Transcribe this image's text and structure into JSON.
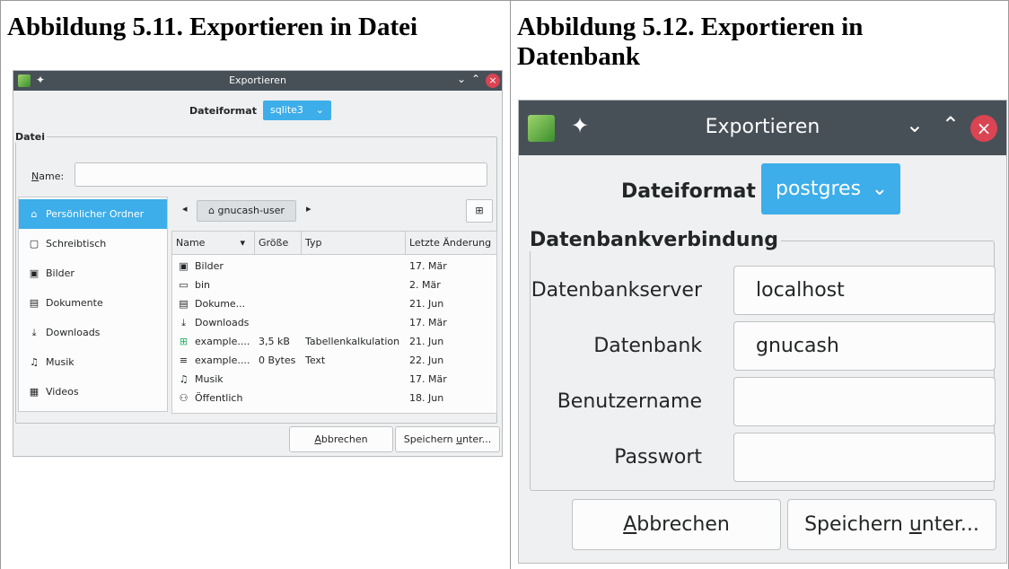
{
  "captions": {
    "left": "Abbildung 5.11. Exportieren in Datei",
    "right": "Abbildung 5.12. Exportieren in Datenbank"
  },
  "file_dialog": {
    "window_title": "Exportieren",
    "format_label": "Dateiformat",
    "format_value": "sqlite3",
    "group_label": "Datei",
    "name_label": "Name:",
    "name_value": "",
    "places": [
      {
        "label": "Persönlicher Ordner",
        "icon": "home-icon",
        "selected": true
      },
      {
        "label": "Schreibtisch",
        "icon": "desktop-icon"
      },
      {
        "label": "Bilder",
        "icon": "pictures-icon"
      },
      {
        "label": "Dokumente",
        "icon": "documents-icon"
      },
      {
        "label": "Downloads",
        "icon": "downloads-icon"
      },
      {
        "label": "Musik",
        "icon": "music-icon"
      },
      {
        "label": "Videos",
        "icon": "videos-icon"
      }
    ],
    "breadcrumb": "gnucash-user",
    "columns": {
      "name": "Name",
      "size": "Größe",
      "type": "Typ",
      "modified": "Letzte Änderung"
    },
    "files": [
      {
        "name": "Bilder",
        "size": "",
        "type": "",
        "modified": "17. Mär",
        "icon": "pictures-icon"
      },
      {
        "name": "bin",
        "size": "",
        "type": "",
        "modified": "2. Mär",
        "icon": "folder-icon"
      },
      {
        "name": "Dokume...",
        "size": "",
        "type": "",
        "modified": "21. Jun",
        "icon": "documents-icon"
      },
      {
        "name": "Downloads",
        "size": "",
        "type": "",
        "modified": "17. Mär",
        "icon": "downloads-icon"
      },
      {
        "name": "example....",
        "size": "3,5 kB",
        "type": "Tabellenkalkulation",
        "modified": "21. Jun",
        "icon": "spreadsheet-icon"
      },
      {
        "name": "example....",
        "size": "0 Bytes",
        "type": "Text",
        "modified": "22. Jun",
        "icon": "text-file-icon"
      },
      {
        "name": "Musik",
        "size": "",
        "type": "",
        "modified": "17. Mär",
        "icon": "music-icon"
      },
      {
        "name": "Öffentlich",
        "size": "",
        "type": "",
        "modified": "18. Jun",
        "icon": "public-icon"
      }
    ],
    "cancel_label": "Abbrechen",
    "save_label": "Speichern unter..."
  },
  "db_dialog": {
    "window_title": "Exportieren",
    "format_label": "Dateiformat",
    "format_value": "postgres",
    "group_label": "Datenbankverbindung",
    "fields": [
      {
        "label": "Datenbankserver",
        "value": "localhost"
      },
      {
        "label": "Datenbank",
        "value": "gnucash"
      },
      {
        "label": "Benutzername",
        "value": ""
      },
      {
        "label": "Passwort",
        "value": ""
      }
    ],
    "cancel_label": "Abbrechen",
    "save_label": "Speichern unter..."
  }
}
